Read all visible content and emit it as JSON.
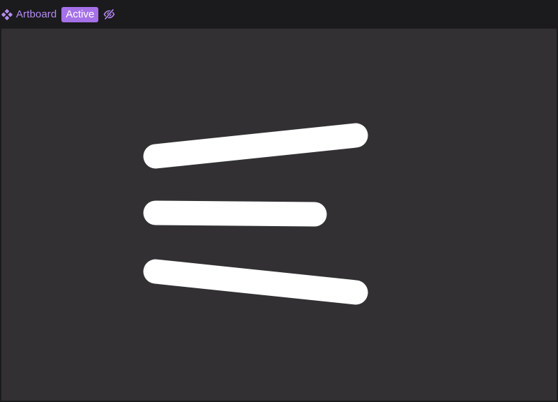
{
  "header": {
    "artboard_label": "Artboard",
    "state_badge": "Active",
    "icons": {
      "artboard": "component-diamond-icon",
      "visibility": "eye-off-icon"
    },
    "accent_color": "#b58cf2",
    "badge_color": "#a571e8"
  },
  "canvas": {
    "background": "#323033",
    "shape_color": "#ffffff",
    "shapes": [
      "stroke-top",
      "stroke-middle",
      "stroke-bottom"
    ]
  }
}
